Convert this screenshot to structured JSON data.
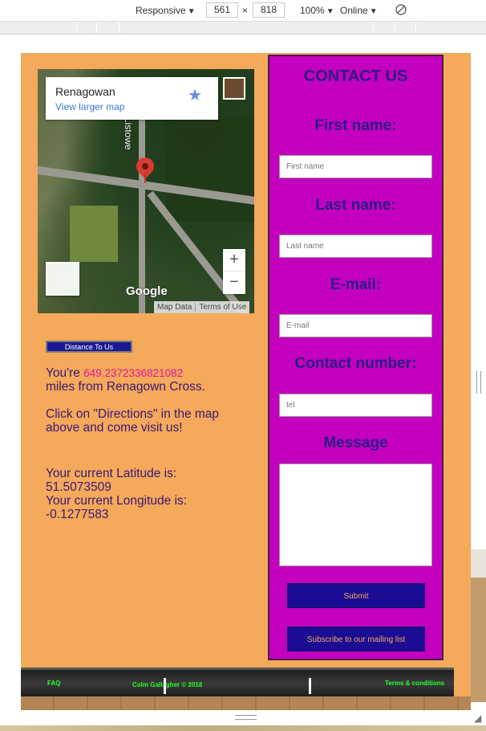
{
  "devtools": {
    "device": "Responsive",
    "width": "561",
    "times": "×",
    "height": "818",
    "zoom": "100%",
    "network": "Online",
    "rotate_icon": "rotate-icon"
  },
  "map": {
    "place_title": "Renagowan",
    "larger_map_link": "View larger map",
    "road_label": "Listowe",
    "zoom_in": "+",
    "zoom_out": "−",
    "logo": "Google",
    "map_data": "Map Data",
    "terms": "Terms of Use"
  },
  "distance": {
    "button_label": "Distance To Us",
    "youre": "You're ",
    "miles_value": "649.2372336821082",
    "miles_suffix": "miles from Renagown Cross.",
    "directions_text": "Click on \"Directions\" in the map above and come visit us!",
    "lat_label": "Your current Latitude is:",
    "lat_value": "51.5073509",
    "lng_label": "Your current Longitude is:",
    "lng_value": "-0.1277583"
  },
  "contact": {
    "heading": "CONTACT US",
    "first_name_label": "First name:",
    "first_name_placeholder": "First name",
    "last_name_label": "Last name:",
    "last_name_placeholder": "Last name",
    "email_label": "E-mail:",
    "email_placeholder": "E-mail",
    "phone_label": "Contact number:",
    "phone_placeholder": "tel",
    "message_label": "Message",
    "submit_label": "Submit",
    "subscribe_label": "Subscribe to our mailing list"
  },
  "footer": {
    "faq": "FAQ",
    "copyright": "Colm Gallagher © 2018",
    "terms": "Terms & conditions"
  },
  "colors": {
    "page_bg": "#f4a95b",
    "contact_bg": "#c400bf",
    "button_bg": "#1b0c93",
    "footer_text": "#22ff2a",
    "distance_value": "#e2189a"
  }
}
